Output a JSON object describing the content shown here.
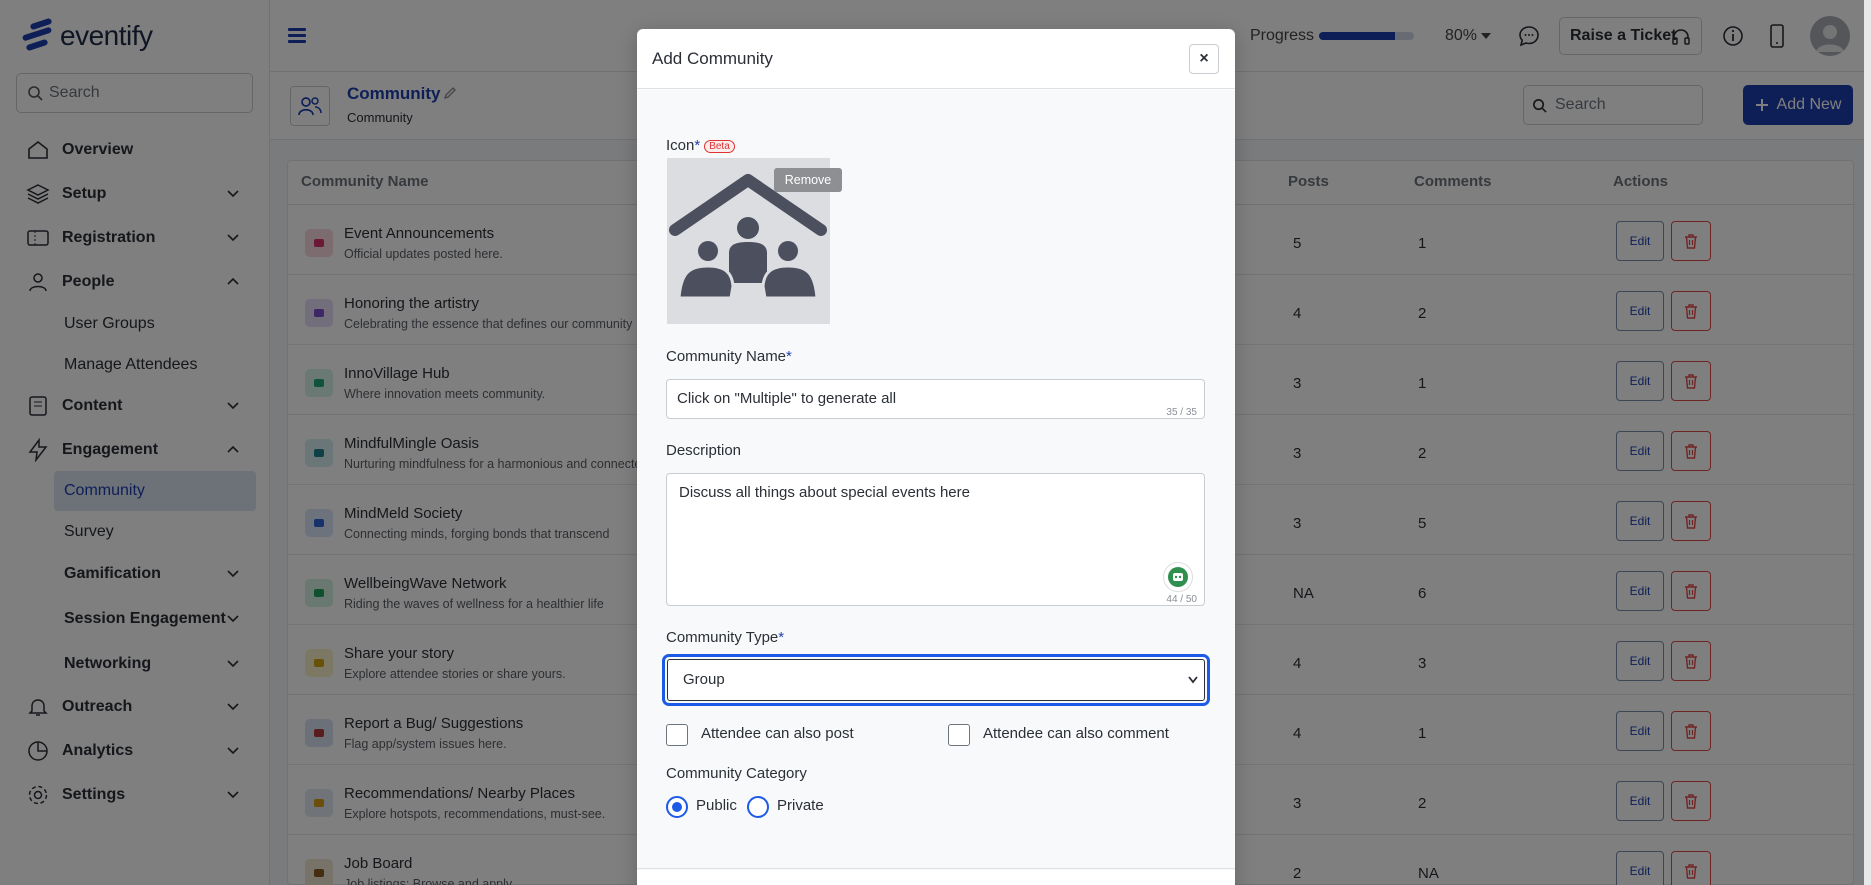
{
  "app": {
    "logo_text": "eventify"
  },
  "sidebar": {
    "search_placeholder": "Search",
    "items": [
      {
        "label": "Overview"
      },
      {
        "label": "Setup"
      },
      {
        "label": "Registration"
      },
      {
        "label": "People"
      },
      {
        "label": "User Groups"
      },
      {
        "label": "Manage Attendees"
      },
      {
        "label": "Content"
      },
      {
        "label": "Engagement"
      },
      {
        "label": "Community"
      },
      {
        "label": "Survey"
      },
      {
        "label": "Gamification"
      },
      {
        "label": "Session Engagement"
      },
      {
        "label": "Networking"
      },
      {
        "label": "Outreach"
      },
      {
        "label": "Analytics"
      },
      {
        "label": "Settings"
      }
    ]
  },
  "topbar": {
    "progress_label": "Progress",
    "progress_value": 80,
    "progress_text": "80%",
    "ticket_label": "Raise a Ticket"
  },
  "page": {
    "title": "Community",
    "breadcrumb": "Community",
    "search_placeholder": "Search",
    "add_new_label": "Add New"
  },
  "table": {
    "headers": {
      "name": "Community Name",
      "posts": "Posts",
      "comments": "Comments",
      "actions": "Actions"
    },
    "edit_label": "Edit",
    "rows": [
      {
        "name": "Event Announcements",
        "desc": "Official updates posted here.",
        "posts": "5",
        "comments": "1",
        "icon_color": "#f8d7de",
        "icon_fg": "#d6336c"
      },
      {
        "name": "Honoring the artistry",
        "desc": "Celebrating the essence that defines our community",
        "posts": "4",
        "comments": "2",
        "icon_color": "#e7dcf7",
        "icon_fg": "#7b4ec9"
      },
      {
        "name": "InnoVillage Hub",
        "desc": "Where innovation meets community.",
        "posts": "3",
        "comments": "1",
        "icon_color": "#d4f3e8",
        "icon_fg": "#20a67a"
      },
      {
        "name": "MindfulMingle Oasis",
        "desc": "Nurturing mindfulness for a harmonious and connected",
        "posts": "3",
        "comments": "2",
        "icon_color": "#d4ecf0",
        "icon_fg": "#1f7f8f"
      },
      {
        "name": "MindMeld Society",
        "desc": "Connecting minds, forging bonds that transcend",
        "posts": "3",
        "comments": "5",
        "icon_color": "#dbe6fa",
        "icon_fg": "#2f63d6"
      },
      {
        "name": "WellbeingWave Network",
        "desc": "Riding the waves of wellness for a healthier life",
        "posts": "NA",
        "comments": "6",
        "icon_color": "#d2f0e0",
        "icon_fg": "#22a05e"
      },
      {
        "name": "Share your story",
        "desc": "Explore attendee stories or share yours.",
        "posts": "4",
        "comments": "3",
        "icon_color": "#fbf1c9",
        "icon_fg": "#d1a411"
      },
      {
        "name": "Report a Bug/ Suggestions",
        "desc": "Flag app/system issues here.",
        "posts": "4",
        "comments": "1",
        "icon_color": "#d9e3f3",
        "icon_fg": "#b43a3a"
      },
      {
        "name": "Recommendations/ Nearby Places",
        "desc": "Explore hotspots, recommendations, must-see.",
        "posts": "3",
        "comments": "2",
        "icon_color": "#e0e6f0",
        "icon_fg": "#d69c15"
      },
      {
        "name": "Job Board",
        "desc": "Job listings: Browse and apply.",
        "posts": "2",
        "comments": "NA",
        "icon_color": "#f0e6d2",
        "icon_fg": "#8a5a22"
      }
    ]
  },
  "modal": {
    "title": "Add Community",
    "close_label": "×",
    "icon_label": "Icon",
    "required_mark": "*",
    "beta_label": "Beta",
    "remove_label": "Remove",
    "name_label": "Community Name",
    "name_value": "Click on \"Multiple\" to generate all",
    "name_counter": "35 / 35",
    "desc_label": "Description",
    "desc_value": "Discuss all things about special events here",
    "desc_counter": "44 / 50",
    "type_label": "Community Type",
    "type_value": "Group",
    "post_label": "Attendee can also post",
    "comment_label": "Attendee can also comment",
    "category_label": "Community Category",
    "public_label": "Public",
    "private_label": "Private",
    "selected_category": "Public"
  },
  "colors": {
    "brand": "#1d3fae",
    "focus": "#1d5ae6",
    "danger": "#e04a4a"
  }
}
